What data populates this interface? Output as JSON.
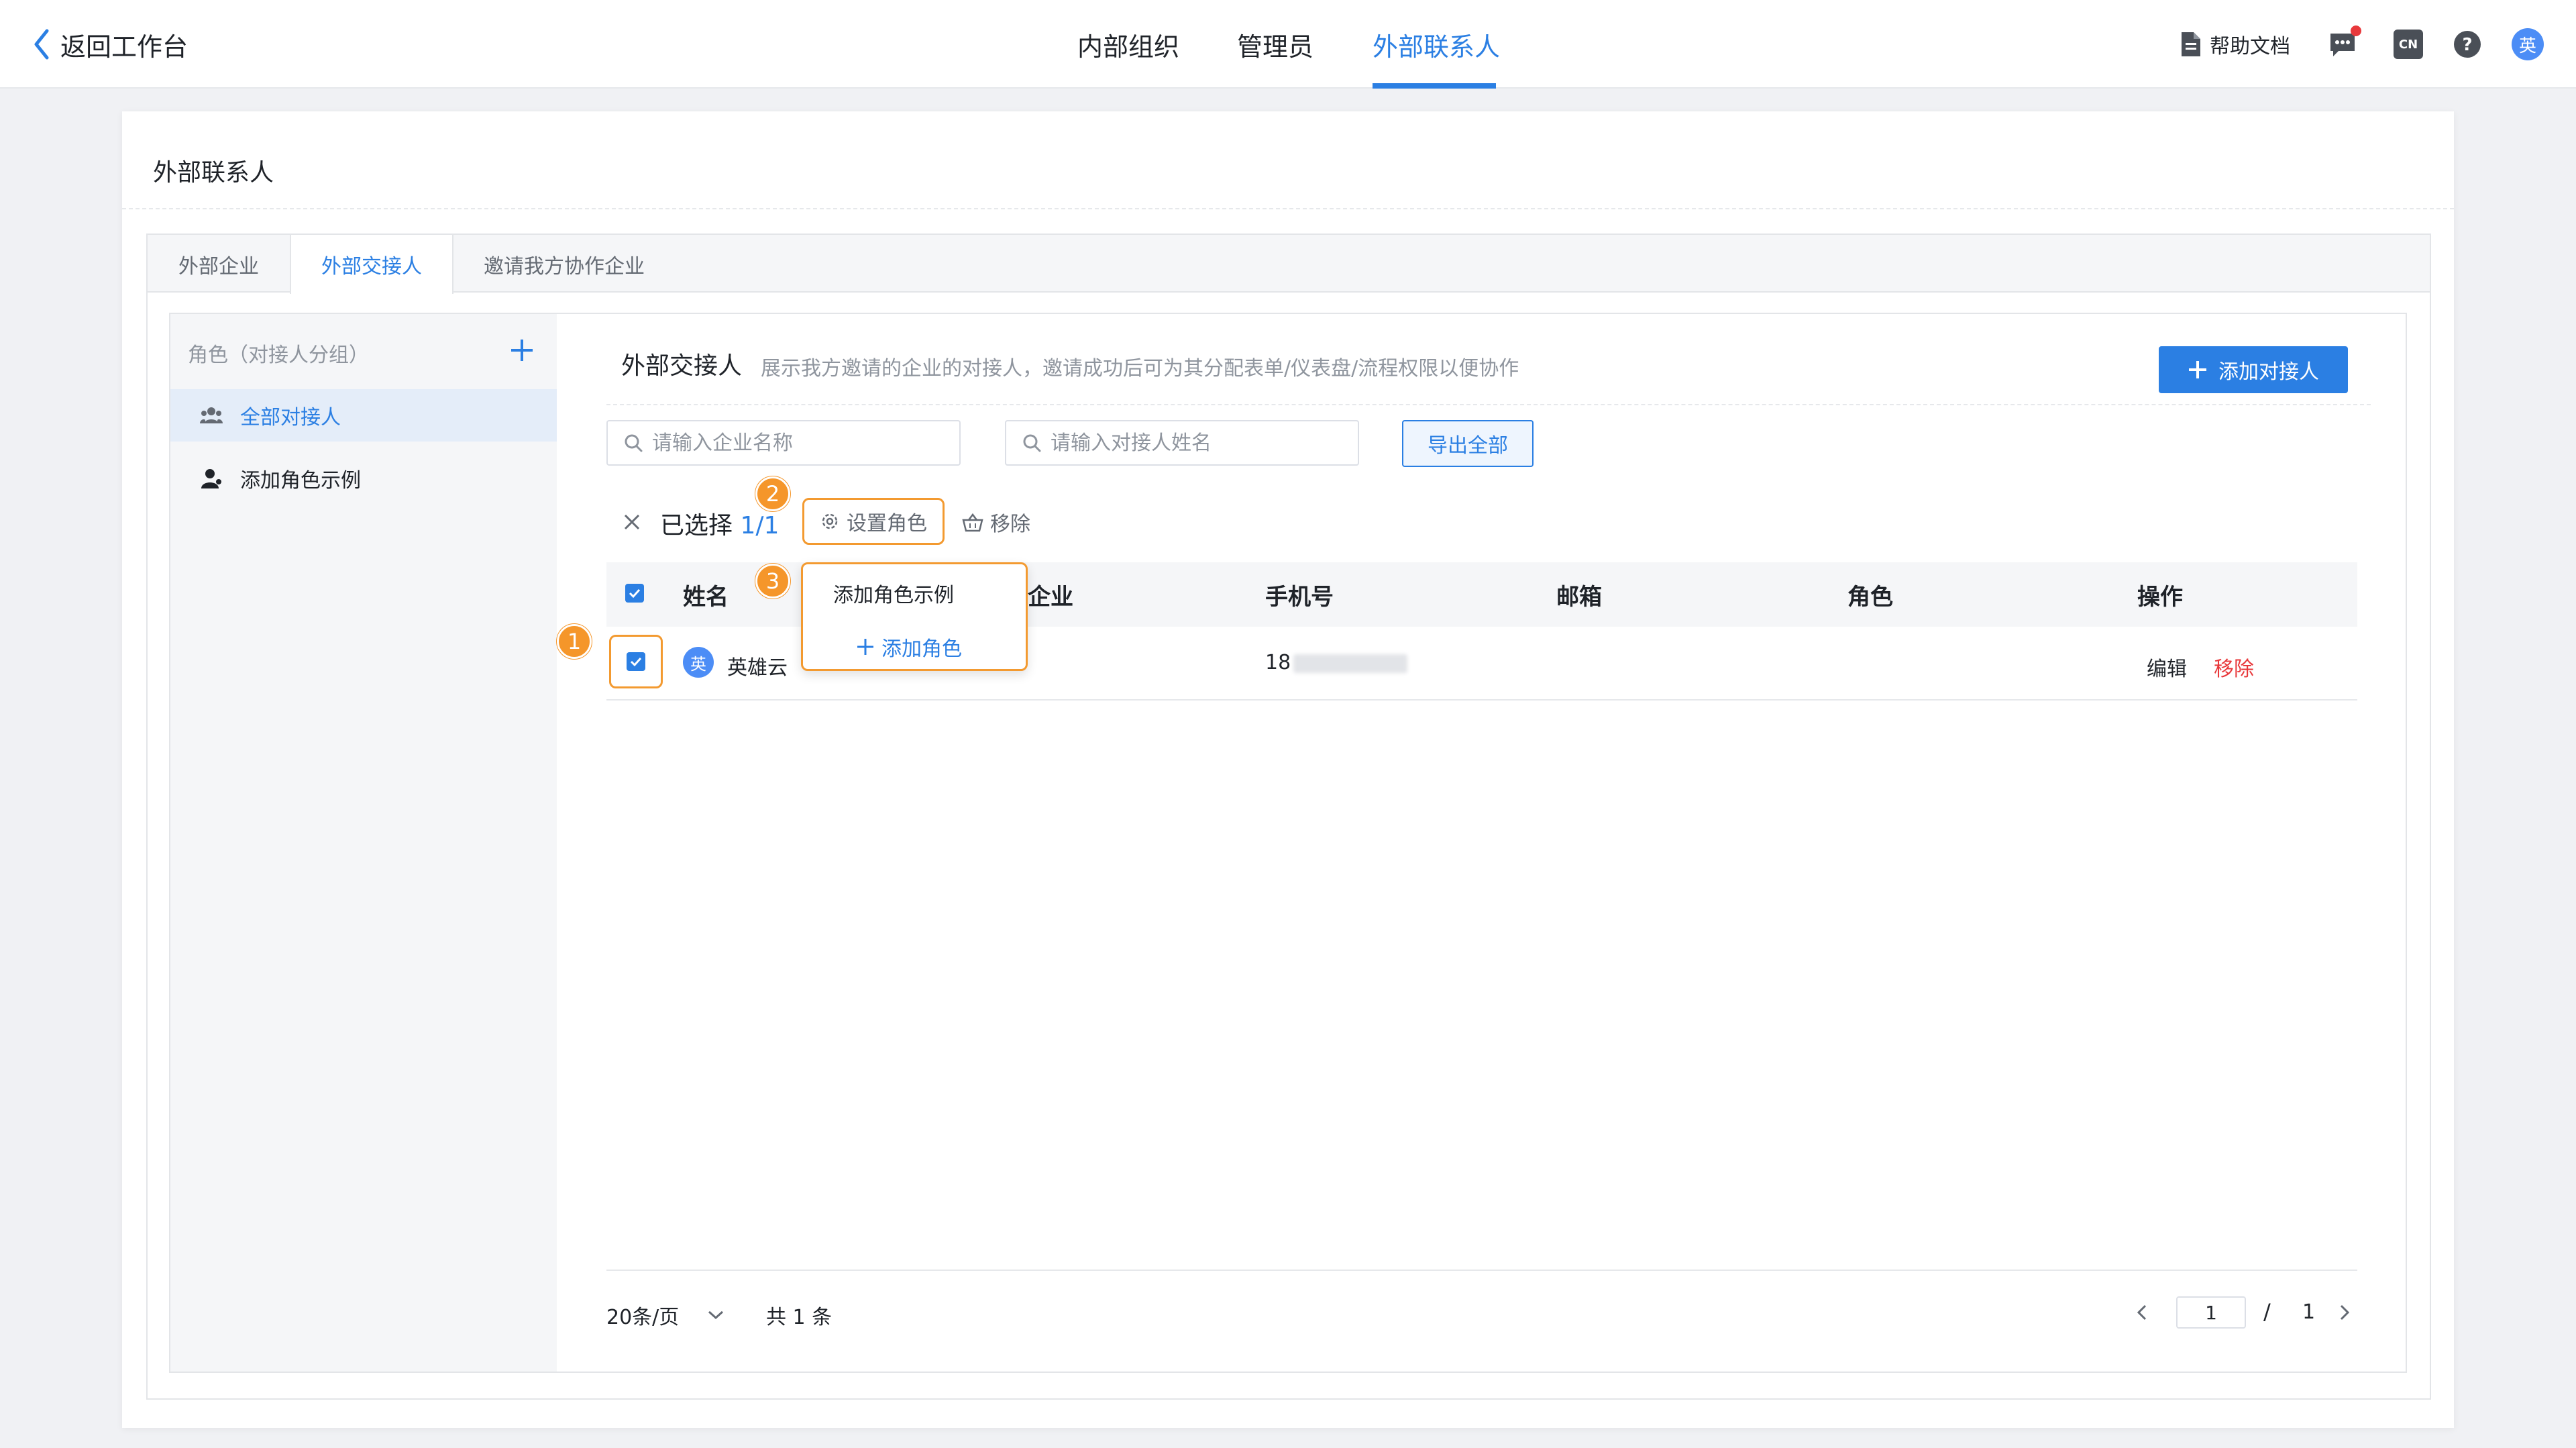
{
  "topbar": {
    "back_label": "返回工作台",
    "tabs": [
      {
        "label": "内部组织"
      },
      {
        "label": "管理员"
      },
      {
        "label": "外部联系人"
      }
    ],
    "help_label": "帮助文档",
    "lang_label": "CN",
    "avatar_text": "英"
  },
  "page": {
    "title": "外部联系人",
    "sub_tabs": [
      {
        "label": "外部企业"
      },
      {
        "label": "外部交接人"
      },
      {
        "label": "邀请我方协作企业"
      }
    ]
  },
  "sidebar": {
    "header": "角色（对接人分组）",
    "items": [
      {
        "label": "全部对接人",
        "icon": "group-icon"
      },
      {
        "label": "添加角色示例",
        "icon": "user-icon"
      }
    ]
  },
  "main": {
    "section_title": "外部交接人",
    "section_desc": "展示我方邀请的企业的对接人，邀请成功后可为其分配表单/仪表盘/流程权限以便协作",
    "add_button": "添加对接人",
    "search_company_placeholder": "请输入企业名称",
    "search_contact_placeholder": "请输入对接人姓名",
    "export_button": "导出全部",
    "selection": {
      "prefix": "已选择",
      "count": "1/1",
      "set_role": "设置角色",
      "remove": "移除"
    },
    "columns": [
      "姓名",
      "企业",
      "手机号",
      "邮箱",
      "角色",
      "操作"
    ],
    "rows": [
      {
        "avatar": "英",
        "name": "英雄云",
        "company": "",
        "phone_prefix": "18",
        "email": "",
        "role": "",
        "edit": "编辑",
        "remove": "移除"
      }
    ],
    "role_dropdown": {
      "option": "添加角色示例",
      "add": "添加角色"
    },
    "steps": [
      "1",
      "2",
      "3"
    ],
    "pagination": {
      "page_size": "20条/页",
      "total": "共 1 条",
      "current": "1",
      "separator": "/",
      "pages": "1"
    }
  },
  "colors": {
    "accent": "#2b7fe3",
    "highlight": "#f39a30",
    "danger": "#e8383b"
  }
}
